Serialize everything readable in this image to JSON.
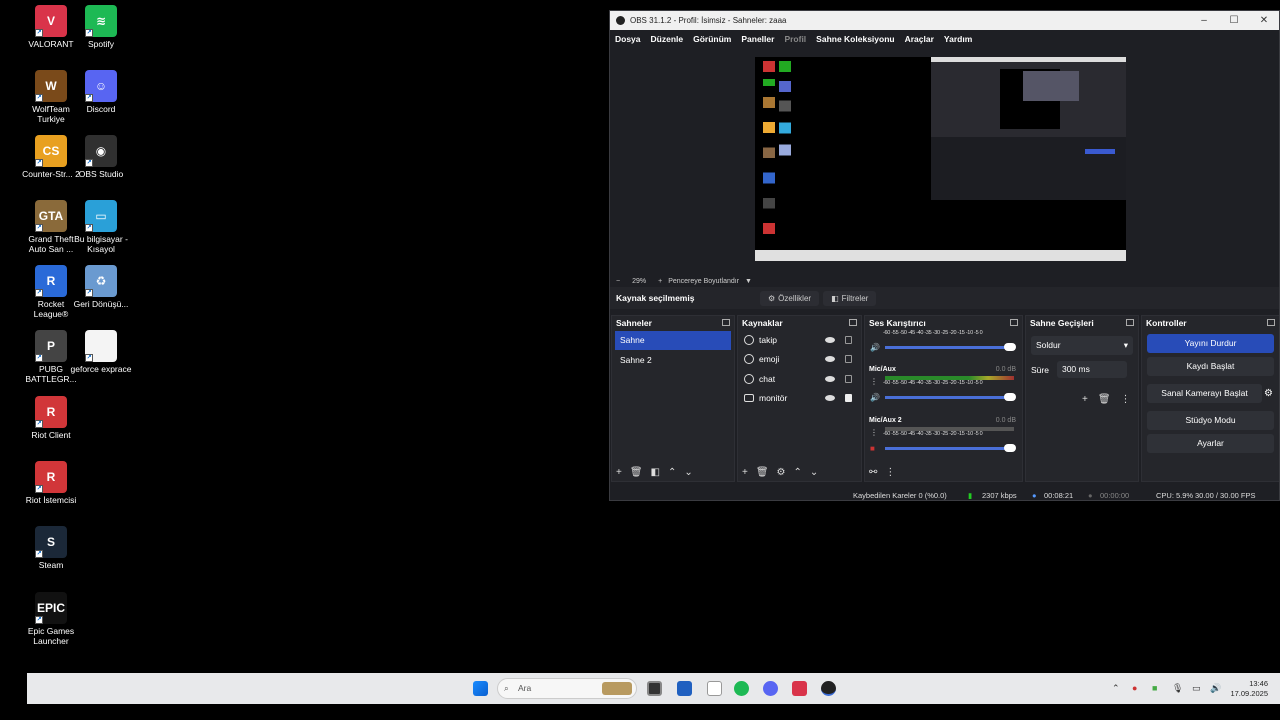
{
  "desktop_icons": [
    {
      "label": "VALORANT",
      "color": "#d9344a",
      "text": "V"
    },
    {
      "label": "Spotify",
      "color": "#1db954",
      "text": "≋"
    },
    {
      "label": "WolfTeam Turkiye",
      "color": "#7a4a1a",
      "text": "W"
    },
    {
      "label": "Discord",
      "color": "#5865f2",
      "text": "☺"
    },
    {
      "label": "Counter-Str... 2",
      "color": "#e8a020",
      "text": "CS"
    },
    {
      "label": "OBS Studio",
      "color": "#303030",
      "text": "◉"
    },
    {
      "label": "Grand Theft Auto San ...",
      "color": "#8a6a3a",
      "text": "GTA"
    },
    {
      "label": "Bu bilgisayar - Kısayol",
      "color": "#2aa0d8",
      "text": "▭"
    },
    {
      "label": "Rocket League®",
      "color": "#2a6ad8",
      "text": "R"
    },
    {
      "label": "Geri Dönüşü...",
      "color": "#6a9ad0",
      "text": "♻"
    },
    {
      "label": "PUBG BATTLEGR...",
      "color": "#444444",
      "text": "P"
    },
    {
      "label": "geforce exprace",
      "color": "#f4f4f4",
      "text": ""
    },
    {
      "label": "Riot Client",
      "color": "#d13639",
      "text": "R"
    },
    {
      "label": "Riot İstemcisi",
      "color": "#d13639",
      "text": "R"
    },
    {
      "label": "Steam",
      "color": "#1b2838",
      "text": "S"
    },
    {
      "label": "Epic Games Launcher",
      "color": "#111111",
      "text": "EPIC"
    }
  ],
  "obs": {
    "title": "OBS 31.1.2 - Profil: İsimsiz - Sahneler: zaaa",
    "menu": [
      "Dosya",
      "Düzenle",
      "Görünüm",
      "Paneller",
      "Profil",
      "Sahne Koleksiyonu",
      "Araçlar",
      "Yardım"
    ],
    "zoom": "29%",
    "fit_label": "Pencereye Boyutlandır",
    "no_source": "Kaynak seçilmemiş",
    "properties": "Özellikler",
    "filters": "Filtreler",
    "scenes_title": "Sahneler",
    "scenes": [
      "Sahne",
      "Sahne 2"
    ],
    "sources_title": "Kaynaklar",
    "sources": [
      {
        "name": "takip",
        "icon": "globe-icon"
      },
      {
        "name": "emoji",
        "icon": "globe-icon"
      },
      {
        "name": "chat",
        "icon": "globe-icon"
      },
      {
        "name": "monitör",
        "icon": "monitor-icon"
      }
    ],
    "mixer_title": "Ses Karıştırıcı",
    "scale_text": "-60 -55 -50 -45 -40 -35 -30 -25 -20 -15 -10 -5  0",
    "channels": [
      {
        "name": "",
        "db": ""
      },
      {
        "name": "Mic/Aux",
        "db": "0.0 dB"
      },
      {
        "name": "Mic/Aux 2",
        "db": "0.0 dB"
      }
    ],
    "transitions_title": "Sahne Geçişleri",
    "transition": "Soldur",
    "duration_label": "Süre",
    "duration": "300 ms",
    "controls_title": "Kontroller",
    "controls": [
      "Yayını Durdur",
      "Kaydı Başlat",
      "Sanal Kamerayı Başlat",
      "Stüdyo Modu",
      "Ayarlar"
    ],
    "status": {
      "dropped": "Kaybedilen Kareler 0 (%0.0)",
      "bitrate": "2307 kbps",
      "stream_time": "00:08:21",
      "rec_time": "00:00:00",
      "cpu": "CPU: 5.9%",
      "fps": "30.00 / 30.00 FPS"
    }
  },
  "taskbar": {
    "search_placeholder": "Ara",
    "time": "13:46",
    "date": "17.09.2025"
  }
}
